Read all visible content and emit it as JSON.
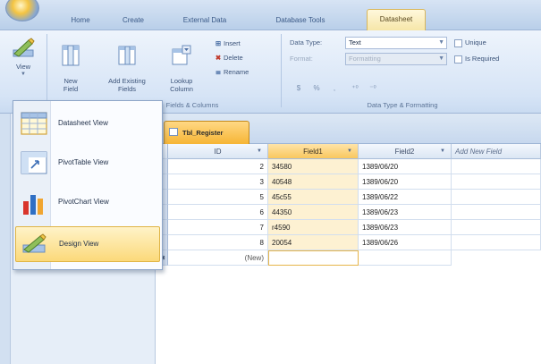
{
  "ribbon_tabs": [
    {
      "label": "Home",
      "active": false
    },
    {
      "label": "Create",
      "active": false
    },
    {
      "label": "External Data",
      "active": false
    },
    {
      "label": "Database Tools",
      "active": false
    },
    {
      "label": "Datasheet",
      "active": true
    }
  ],
  "ribbon": {
    "view_button": "View",
    "new_field": "New\nField",
    "add_existing_fields": "Add Existing\nFields",
    "lookup_column": "Lookup\nColumn",
    "insert": "Insert",
    "delete": "Delete",
    "rename": "Rename",
    "fields_columns_group": "Fields & Columns",
    "data_type_label": "Data Type:",
    "data_type_value": "Text",
    "format_label": "Format:",
    "format_value": "Formatting",
    "unique_label": "Unique",
    "is_required_label": "Is Required",
    "data_type_group": "Data Type & Formatting"
  },
  "view_menu": [
    {
      "label": "Datasheet View",
      "icon": "datasheet-icon",
      "hover": false
    },
    {
      "label": "PivotTable View",
      "icon": "pivottable-icon",
      "hover": false
    },
    {
      "label": "PivotChart View",
      "icon": "pivotchart-icon",
      "hover": false
    },
    {
      "label": "Design View",
      "icon": "design-icon",
      "hover": true
    }
  ],
  "document_tab": "Tbl_Register",
  "grid": {
    "columns": [
      "ID",
      "Field1",
      "Field2",
      "Add New Field"
    ],
    "selected_column": "Field1",
    "rows": [
      {
        "id": "2",
        "field1": "34580",
        "field2": "1389/06/20"
      },
      {
        "id": "3",
        "field1": "40548",
        "field2": "1389/06/20"
      },
      {
        "id": "5",
        "field1": "45c55",
        "field2": "1389/06/22"
      },
      {
        "id": "6",
        "field1": "44350",
        "field2": "1389/06/23"
      },
      {
        "id": "7",
        "field1": "r4590",
        "field2": "1389/06/23"
      },
      {
        "id": "8",
        "field1": "20054",
        "field2": "1389/06/26"
      }
    ],
    "new_row_label": "(New)"
  },
  "colors": {
    "accent_orange": "#f6b535",
    "ribbon_blue": "#d6e4f6",
    "hover_gold": "#fbd97a"
  }
}
